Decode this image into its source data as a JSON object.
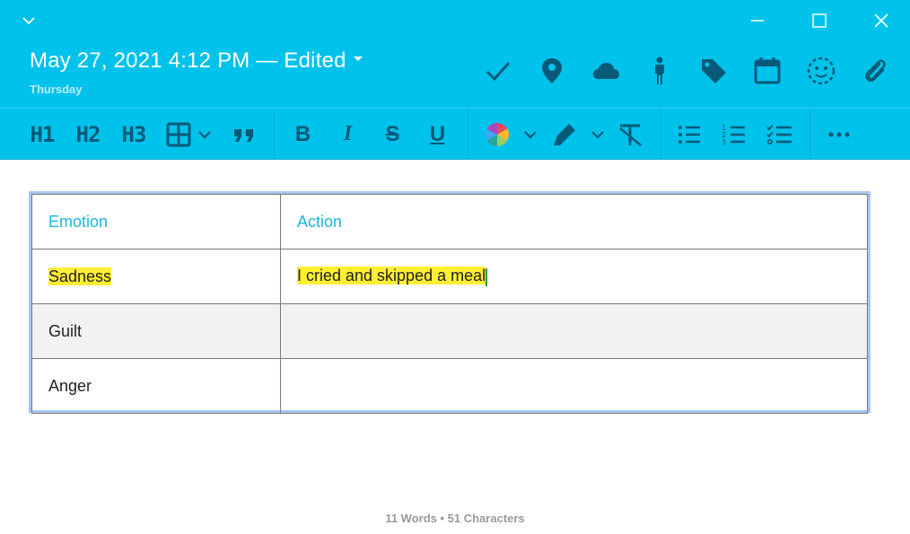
{
  "header": {
    "date": "May 27, 2021 4:12 PM — Edited",
    "day": "Thursday",
    "icons": [
      "checkmark-icon",
      "location-pin-icon",
      "cloud-icon",
      "person-icon",
      "tag-icon",
      "calendar-icon",
      "emoji-icon",
      "paperclip-icon"
    ]
  },
  "toolbar": {
    "h1": "H1",
    "h2": "H2",
    "h3": "H3",
    "bold": "B",
    "italic": "I",
    "strike": "S",
    "underline": "U"
  },
  "table": {
    "headers": [
      "Emotion",
      "Action"
    ],
    "rows": [
      [
        "Sadness",
        "I cried and skipped a meal"
      ],
      [
        "Guilt",
        ""
      ],
      [
        "Anger",
        ""
      ]
    ]
  },
  "footer": {
    "stats": "11 Words • 51 Characters"
  },
  "colors": {
    "header_bg": "#00c2ea",
    "icon": "#065a78",
    "highlight": "#ffee33",
    "table_header_text": "#17b8dc"
  }
}
